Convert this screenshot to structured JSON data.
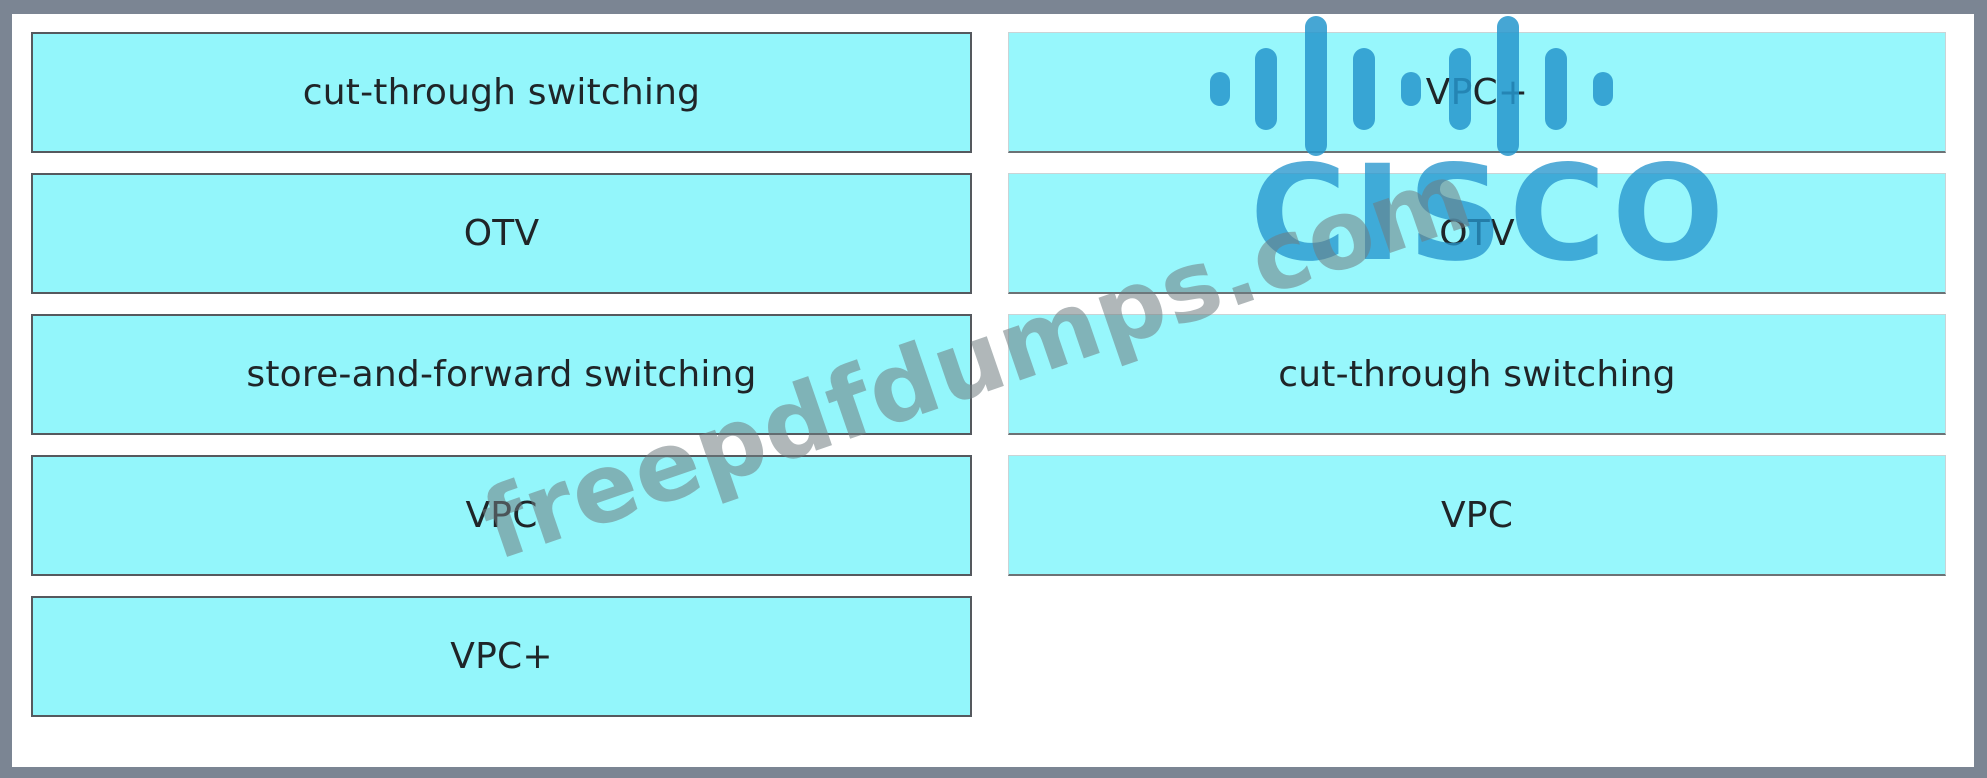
{
  "left_column": {
    "items": [
      "cut-through switching",
      "OTV",
      "store-and-forward switching",
      "VPC",
      "VPC+"
    ]
  },
  "right_column": {
    "items": [
      "VPC+",
      "OTV",
      "cut-through switching",
      "VPC"
    ]
  },
  "logo": {
    "text": "CISCO",
    "color": "#2e9bd0"
  },
  "watermark": {
    "text": "freepdfdumps.com"
  },
  "colors": {
    "tile_fill": "#93f6fb",
    "frame": "#7b8593"
  }
}
